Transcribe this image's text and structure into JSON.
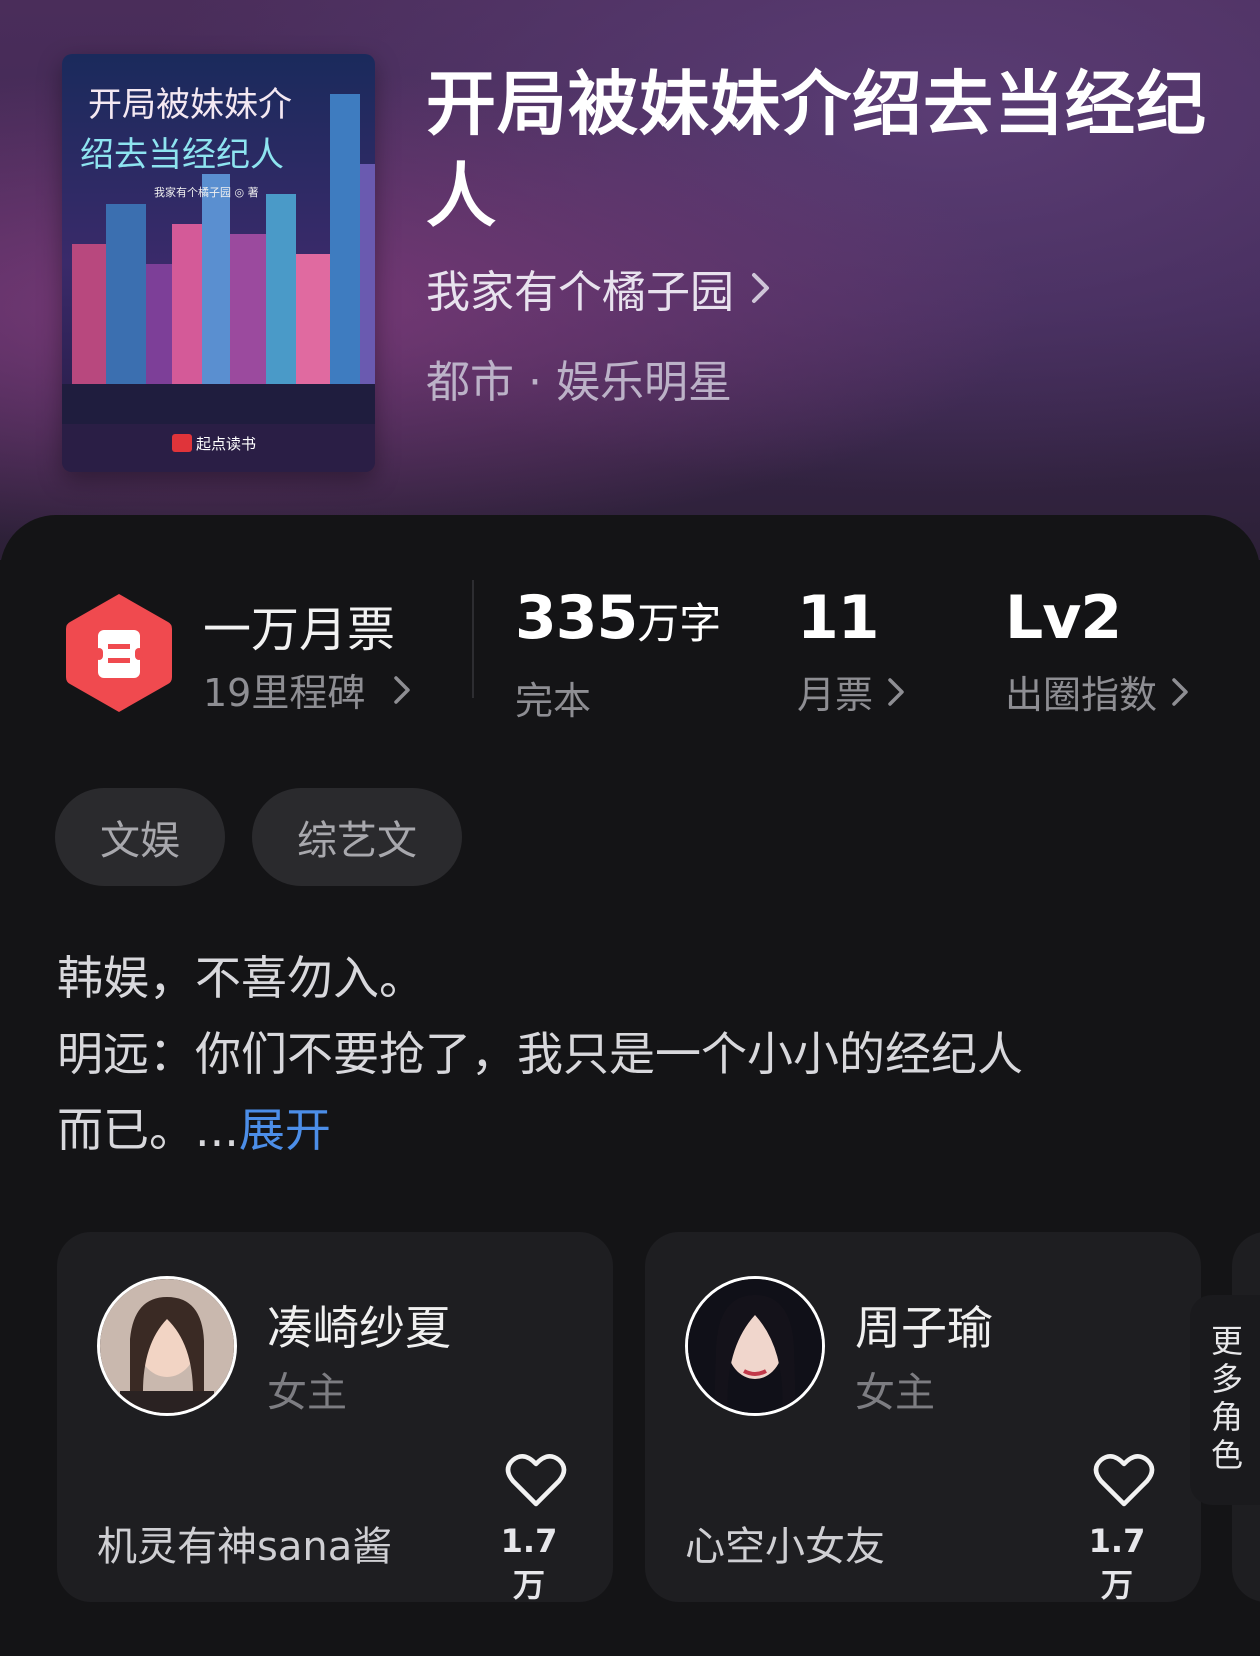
{
  "book": {
    "title": "开局被妹妹介绍去当经纪人",
    "author": "我家有个橘子园",
    "genre": "都市 · 娱乐明星",
    "cover": {
      "title_line1": "开局被妹妹介",
      "title_line2": "绍去当经纪人",
      "author_credit": "我家有个橘子园 ◎ 著",
      "publisher": "起点读书"
    }
  },
  "stats": {
    "monthly_ticket_rank": "一万月票",
    "milestones": "19里程碑",
    "word_count_value": "335",
    "word_count_unit": "万字",
    "status": "完本",
    "monthly_tickets_value": "11",
    "monthly_tickets_label": "月票",
    "influence_value": "Lv2",
    "influence_label": "出圈指数"
  },
  "tags": [
    "文娱",
    "综艺文"
  ],
  "synopsis": {
    "line1": "韩娱，不喜勿入。",
    "line2": "明远：你们不要抢了，我只是一个小小的经纪人",
    "line3": "而已。...",
    "expand_label": "展开"
  },
  "characters": [
    {
      "name": "凑崎纱夏",
      "role": "女主",
      "nickname": "机灵有神sana酱",
      "likes": "1.7万"
    },
    {
      "name": "周子瑜",
      "role": "女主",
      "nickname": "心空小女友",
      "likes": "1.7万"
    }
  ],
  "more_roles_label": "更多角色",
  "colors": {
    "ticket_red": "#f04a4f",
    "expand_blue": "#4c8ee8",
    "panel_bg": "#141416",
    "card_bg": "#1e1e21"
  },
  "icons": [
    "ticket-icon",
    "chevron-right-icon",
    "heart-icon"
  ]
}
